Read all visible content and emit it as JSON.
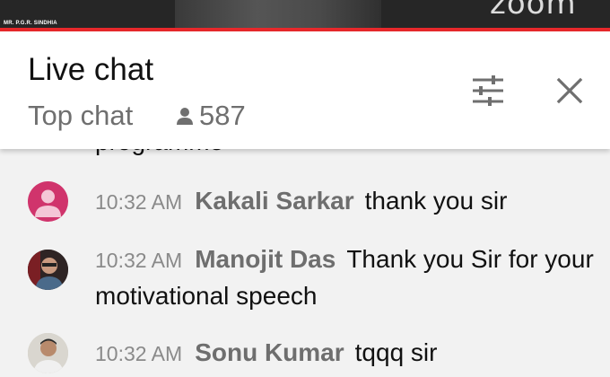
{
  "video": {
    "speaker_label": "MR. P.G.R. SINDHIA",
    "logo_text": "zoom"
  },
  "header": {
    "title": "Live chat",
    "mode": "Top chat",
    "viewer_count": "587",
    "icons": {
      "viewers": "person-icon",
      "settings": "sliders-icon",
      "close": "close-icon"
    }
  },
  "messages": {
    "previous_fragment": "programme",
    "items": [
      {
        "time": "10:32 AM",
        "author": "Kakali Sarkar",
        "text": "thank you sir",
        "avatar": "default-avatar",
        "avatar_color": "#d0346c"
      },
      {
        "time": "10:32 AM",
        "author": "Manojit Das",
        "text": "Thank you Sir for your motivational speech",
        "avatar": "photo-avatar"
      },
      {
        "time": "10:32 AM",
        "author": "Sonu Kumar",
        "text": "tqqq sir",
        "avatar": "photo-avatar"
      }
    ]
  },
  "colors": {
    "accent_red": "#e8282b",
    "author_gray": "#6e6e6e",
    "time_gray": "#8a8a8a"
  }
}
